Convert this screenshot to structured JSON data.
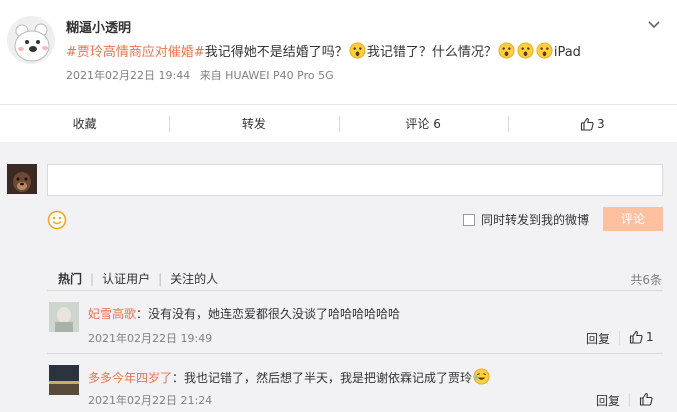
{
  "post": {
    "username": "糊逼小透明",
    "topic": "#贾玲高情商应对催婚#",
    "text_1": "我记得她不是结婚了吗？",
    "text_2": "我记错了？什么情况？",
    "text_3": "iPad",
    "timestamp": "2021年02月22日 19:44",
    "source": "来自 HUAWEI P40 Pro 5G"
  },
  "actions": {
    "favorite": "收藏",
    "repost": "转发",
    "comment": "评论 6",
    "like_count": "3"
  },
  "composer": {
    "input_value": "",
    "repost_label": "同时转发到我的微博",
    "submit_label": "评论"
  },
  "filters": {
    "hot": "热门",
    "verified": "认证用户",
    "following": "关注的人",
    "total": "共6条"
  },
  "comments": [
    {
      "name": "妃雪高歌",
      "text": "：没有没有，她连恋爱都很久没谈了哈哈哈哈哈哈",
      "time": "2021年02月22日 19:49",
      "reply": "回复",
      "likes": "1"
    },
    {
      "name": "多多今年四岁了",
      "text": "：我也记错了，然后想了半天，我是把谢依霖记成了贾玲",
      "time": "2021年02月22日 21:24",
      "reply": "回复",
      "likes": ""
    }
  ],
  "colors": {
    "accent": "#eb7350",
    "button_disabled": "#ffc09f",
    "muted": "#808080"
  }
}
